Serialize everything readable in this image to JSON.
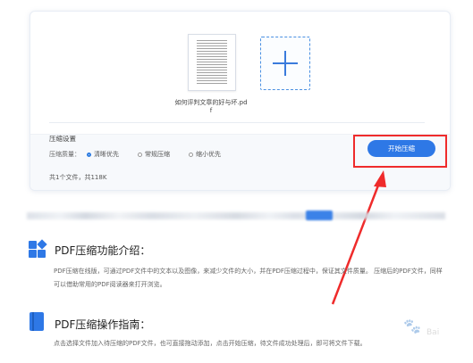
{
  "upload_card": {
    "file_name": "如何评判文章的好与坏.pdf",
    "compress_settings_title": "压缩设置",
    "quality_label": "压缩质量：",
    "quality_options": [
      {
        "label": "清晰优先",
        "selected": true
      },
      {
        "label": "常规压缩",
        "selected": false
      },
      {
        "label": "缩小优先",
        "selected": false
      }
    ],
    "file_summary": "共1个文件，共118K",
    "start_button": "开始压缩"
  },
  "section_intro": {
    "title": "PDF压缩功能介绍：",
    "text": "PDF压缩在线版，可通过PDF文件中的文本以及图像，来减少文件的大小，并在PDF压缩过程中，保证其文件质量。 压缩后的PDF文件，同样可以借助常用的PDF阅读器来打开浏览。"
  },
  "section_guide": {
    "title": "PDF压缩操作指南：",
    "text": "点击选择文件加入待压缩的PDF文件，也可直接拖动添加，点击开始压缩，待文件成功处理后，即可将文件下载。"
  },
  "colors": {
    "accent": "#2e78e6",
    "highlight_red": "#ef2b2b"
  },
  "icons": {
    "add": "plus-icon",
    "section_intro": "app-grid-icon",
    "section_guide": "book-icon"
  },
  "watermark": {
    "text": "Bai"
  }
}
